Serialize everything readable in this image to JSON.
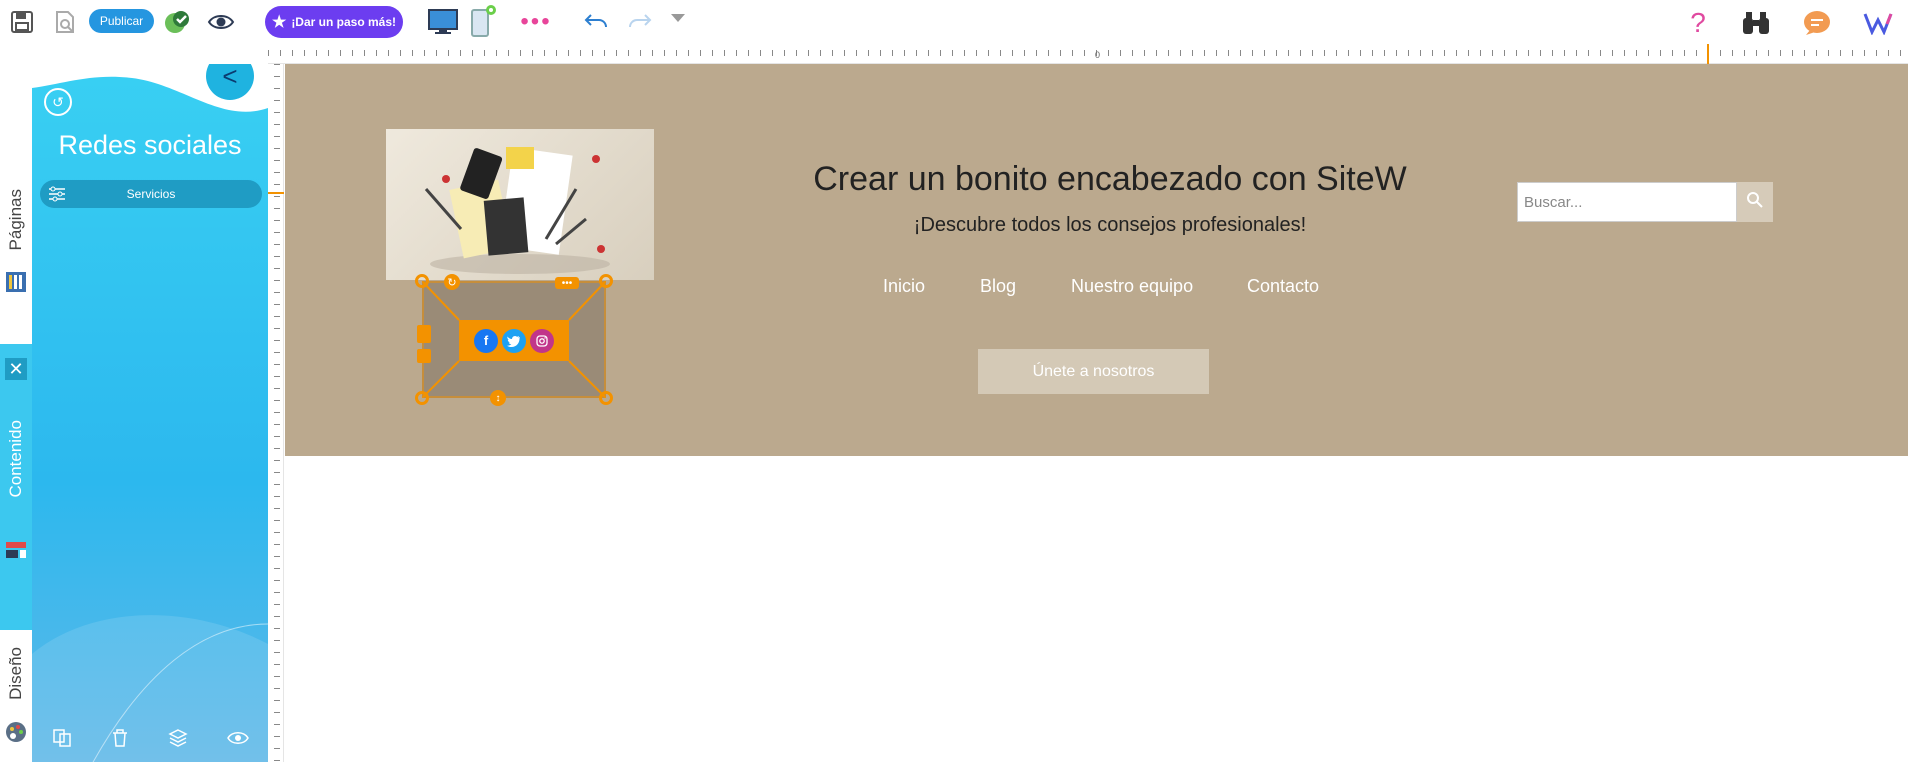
{
  "toolbar": {
    "publish_label": "Publicar",
    "upgrade_label": "¡Dar un paso más!"
  },
  "tabs": {
    "pages": "Páginas",
    "content": "Contenido",
    "design": "Diseño"
  },
  "panel": {
    "title": "Redes sociales",
    "service_label": "Servicios"
  },
  "page": {
    "heading": "Crear un bonito encabezado con SiteW",
    "subheading": "¡Descubre todos los consejos profesionales!",
    "nav": [
      "Inicio",
      "Blog",
      "Nuestro equipo",
      "Contacto"
    ],
    "search_placeholder": "Buscar...",
    "join_label": "Únete a nosotros"
  },
  "ruler": {
    "label": "0"
  },
  "colors": {
    "accent": "#f39200",
    "panel": "#39d0f3",
    "header_bg": "#bba98e",
    "upgrade": "#6c3df0",
    "publish": "#2596e0"
  },
  "icons": [
    "save-icon",
    "preview-page-icon",
    "globe-check-icon",
    "eye-icon",
    "star-icon",
    "desktop-icon",
    "mobile-icon",
    "more-dots-icon",
    "undo-icon",
    "redo-icon",
    "dropdown-icon",
    "help-icon",
    "binoculars-icon",
    "chat-icon",
    "sitew-logo-icon"
  ]
}
